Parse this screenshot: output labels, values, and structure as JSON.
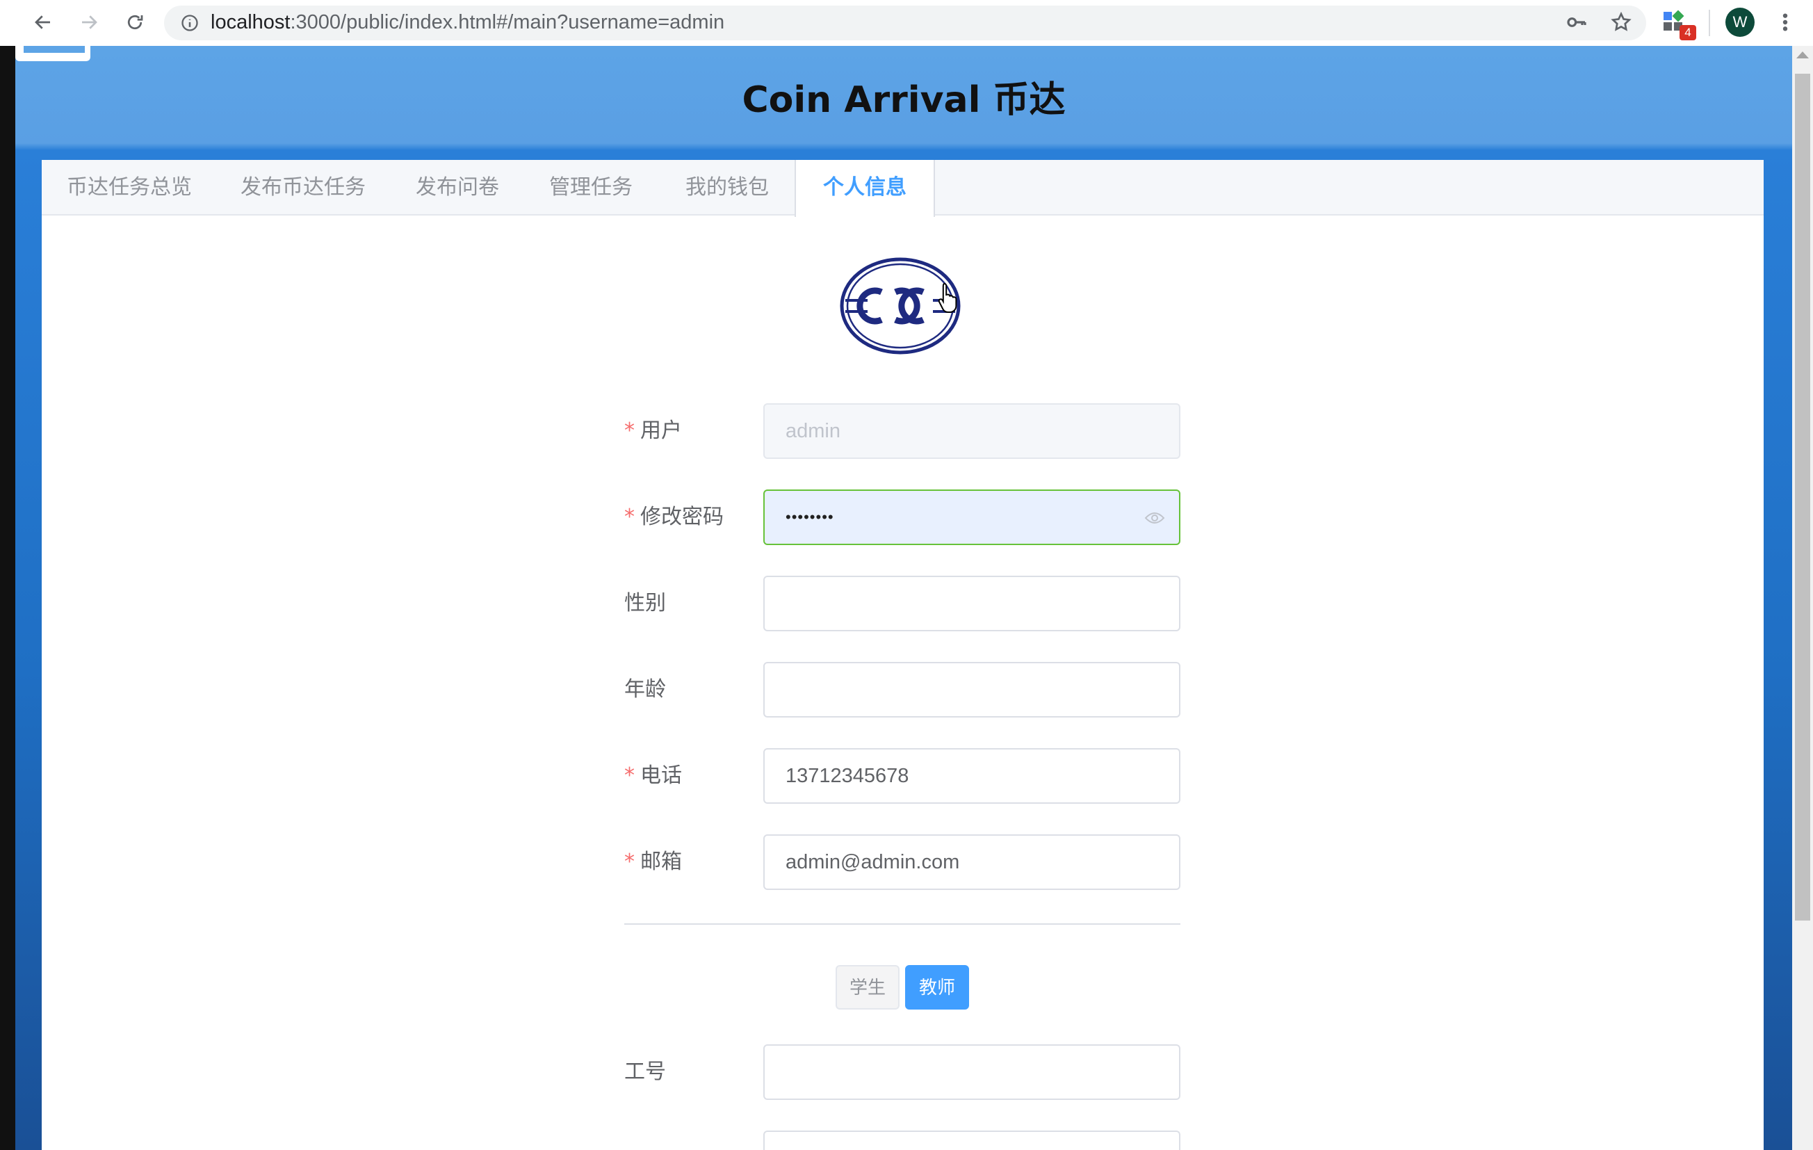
{
  "browser": {
    "url_host": "localhost",
    "url_rest": ":3000/public/index.html#/main?username=admin",
    "extension_badge": "4",
    "profile_initial": "W",
    "icons": [
      "back-arrow-icon",
      "forward-arrow-icon",
      "reload-icon",
      "site-info-icon",
      "key-icon",
      "star-icon",
      "extensions-icon",
      "more-vert-icon"
    ]
  },
  "app": {
    "title": "Coin Arrival 币达"
  },
  "tabs": [
    {
      "label": "币达任务总览"
    },
    {
      "label": "发布币达任务"
    },
    {
      "label": "发布问卷"
    },
    {
      "label": "管理任务"
    },
    {
      "label": "我的钱包"
    },
    {
      "label": "个人信息",
      "active": true
    }
  ],
  "form": {
    "required_mark": "*",
    "username": {
      "label": "用户",
      "value": "admin",
      "disabled": true,
      "required": true
    },
    "password": {
      "label": "修改密码",
      "value": "••••••••",
      "required": true
    },
    "gender": {
      "label": "性别",
      "value": ""
    },
    "age": {
      "label": "年龄",
      "value": ""
    },
    "phone": {
      "label": "电话",
      "value": "13712345678",
      "required": true
    },
    "email": {
      "label": "邮箱",
      "value": "admin@admin.com",
      "required": true
    },
    "role_toggle": {
      "student_label": "学生",
      "teacher_label": "教师",
      "selected": "教师"
    },
    "staff_id": {
      "label": "工号",
      "value": ""
    }
  },
  "colors": {
    "header_blue": "#5da4e6",
    "accent": "#409eff",
    "required": "#f56c6c",
    "focus_border": "#67c23a"
  }
}
